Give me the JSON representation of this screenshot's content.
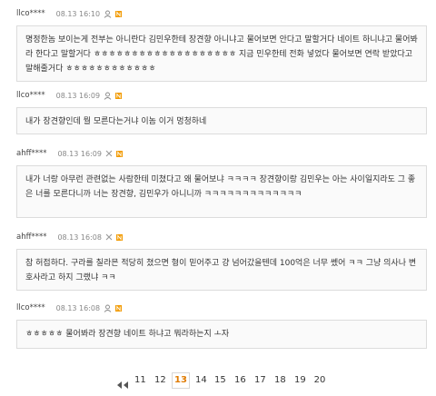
{
  "comments": [
    {
      "user": "llco****",
      "date": "08.13 16:10",
      "icons": [
        "user-icon",
        "n-badge"
      ],
      "text": "명정한놈 보이는게 전부는 아니란다 김민우한테 장견향 아니냐고 물어보면 안다고 말할거다 네이트 하니냐고 물어봐라 한다고 말할거다 ㅎㅎㅎㅎㅎㅎㅎㅎㅎㅎㅎㅎㅎㅎㅎㅎㅎㅎㅎ 지금 민우한테 전화 넣었다 물어보면 연락 받았다고 말해줄거다 ㅎㅎㅎㅎㅎㅎㅎㅎㅎㅎㅎㅎ"
    },
    {
      "user": "llco****",
      "date": "08.13 16:09",
      "icons": [
        "user-icon",
        "n-badge"
      ],
      "text": "내가 장견향인데 뭘 모른다는거냐 이놈 이거 멍청하네"
    },
    {
      "user": "ahff****",
      "date": "08.13 16:09",
      "icons": [
        "close-icon",
        "n-badge"
      ],
      "text": "내가 너랑 아무런 관련없는 사람한테 미쳤다고 왜 물어보냐 ㅋㅋㅋㅋ 장견향이랑 김민우는 아는 사이일지라도 그 좋은 너를 모른다니까 너는 장견향, 김민우가 아니니까 ㅋㅋㅋㅋㅋㅋㅋㅋㅋㅋㅋㅋㅋ"
    },
    {
      "user": "ahff****",
      "date": "08.13 16:08",
      "icons": [
        "close-icon",
        "n-badge"
      ],
      "text": "참 허접하다. 구라를 칠라믄 적당히 쳤으면 형이 믿어주고 걍 넘어갔을텐데 100억은 너무 쎘어 ㅋㅋ 그냥 의사나 변호사라고 하지 그랬냐 ㅋㅋ"
    },
    {
      "user": "llco****",
      "date": "08.13 16:08",
      "icons": [
        "user-icon",
        "n-badge"
      ],
      "text": "ㅎㅎㅎㅎㅎ 물어봐라 장견향 네이트 하냐고 뭐라하는지 ㅗ자"
    }
  ],
  "pagination": {
    "pages": [
      "11",
      "12",
      "13",
      "14",
      "15",
      "16",
      "17",
      "18",
      "19",
      "20"
    ],
    "current": "13"
  },
  "colors": {
    "accent": "#e07b00",
    "border": "#dcdcdc",
    "box_bg": "#fafafa"
  }
}
